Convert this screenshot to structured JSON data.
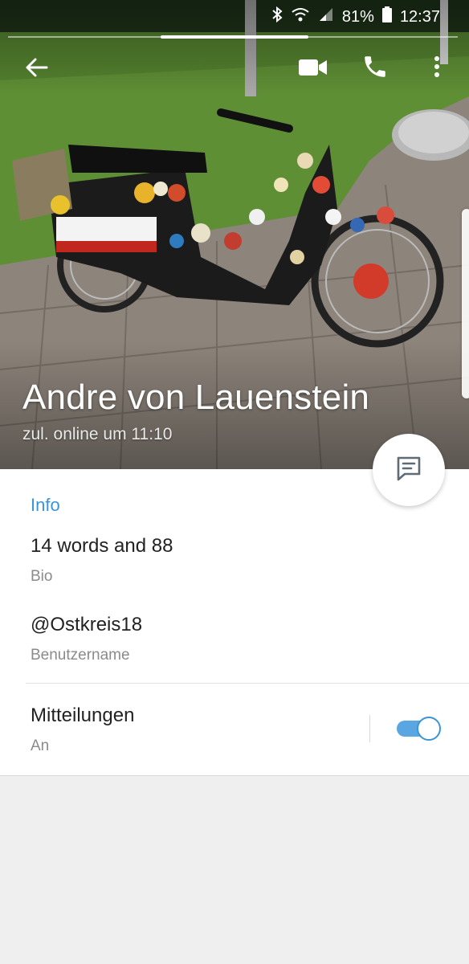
{
  "status_bar": {
    "battery": "81%",
    "time": "12:37",
    "icons": [
      "bluetooth-icon",
      "wifi-icon",
      "signal-icon",
      "battery-icon"
    ]
  },
  "toolbar": {
    "icons": [
      "back-arrow-icon",
      "video-call-icon",
      "phone-icon",
      "more-vert-icon"
    ]
  },
  "profile": {
    "name": "Andre von Lauenstein",
    "last_seen": "zul. online um 11:10"
  },
  "fab": {
    "icon": "message-icon"
  },
  "info": {
    "section_title": "Info",
    "bio_value": "14 words and 88",
    "bio_label": "Bio",
    "username_value": "@Ostkreis18",
    "username_label": "Benutzername",
    "notifications_value": "Mitteilungen",
    "notifications_label": "An",
    "notifications_enabled": true
  },
  "colors": {
    "accent": "#3a95d5",
    "toggle_track": "#5aa6e2",
    "background": "#efefef"
  }
}
